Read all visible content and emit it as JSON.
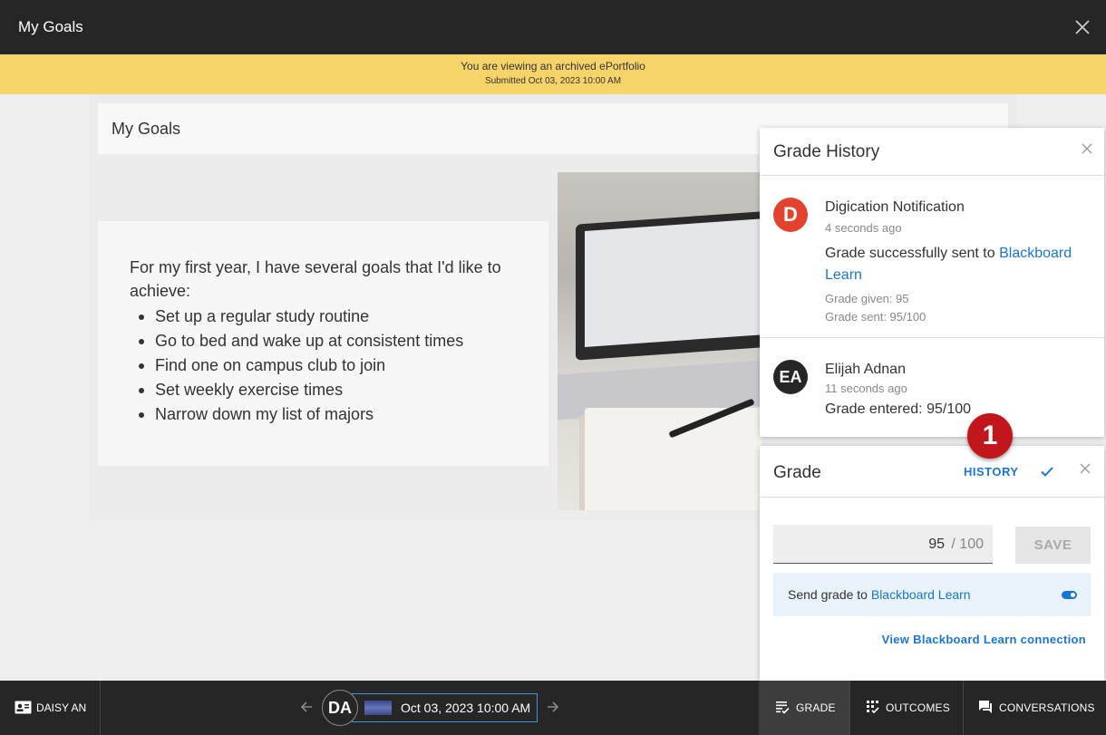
{
  "window": {
    "title": "My Goals"
  },
  "banner": {
    "line1": "You are viewing an archived ePortfolio",
    "line2": "Submitted Oct 03, 2023 10:00 AM"
  },
  "page": {
    "section_title": "My Goals",
    "intro": "For my first year, I have several goals that I'd like to achieve:",
    "goals": [
      "Set up a regular study routine",
      "Go to bed and wake up at consistent times",
      "Find one on campus club to join",
      "Set weekly exercise times",
      "Narrow down my list of majors"
    ]
  },
  "grade_history": {
    "title": "Grade History",
    "entries": [
      {
        "avatar": "D",
        "name": "Digication Notification",
        "time": "4 seconds ago",
        "message_prefix": "Grade successfully sent to ",
        "message_link": "Blackboard Learn",
        "grade_given": "Grade given: 95",
        "grade_sent": "Grade sent: 95/100"
      },
      {
        "avatar": "EA",
        "name": "Elijah Adnan",
        "time": "11 seconds ago",
        "message": "Grade entered: 95/100"
      }
    ]
  },
  "step_badge": "1",
  "grade_panel": {
    "title": "Grade",
    "history_label": "HISTORY",
    "score": "95",
    "max": "/ 100",
    "save_label": "SAVE",
    "send_prefix": "Send grade to ",
    "send_link": "Blackboard Learn",
    "send_enabled": true,
    "view_connection": "View Blackboard Learn connection"
  },
  "bottom_bar": {
    "user_label": "DAISY AN",
    "avatar_initials": "DA",
    "submission_date": "Oct 03, 2023 10:00 AM",
    "tabs": {
      "grade": "GRADE",
      "outcomes": "OUTCOMES",
      "conversations": "CONVERSATIONS"
    }
  },
  "colors": {
    "accent": "#1976d2",
    "banner": "#f7d46a",
    "topbar": "#262626",
    "badge": "#c0161c"
  }
}
